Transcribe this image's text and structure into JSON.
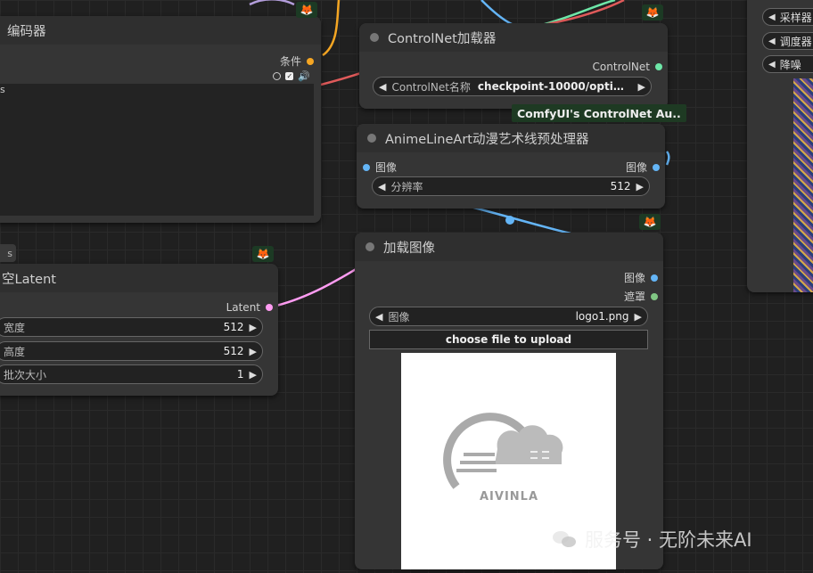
{
  "encoder_node": {
    "title": "编码器",
    "output_label": "条件",
    "input_label": "s",
    "badge_icon": "fox-icon"
  },
  "controlnet_loader": {
    "title": "ControlNet加载器",
    "output_label": "ControlNet",
    "widget_label": "ControlNet名称",
    "widget_value": "checkpoint-10000/optimi...",
    "tooltip": "ComfyUI's ControlNet Au..",
    "badge_icon": "fox-icon"
  },
  "lineart_node": {
    "title": "AnimeLineArt动漫艺术线预处理器",
    "input_label": "图像",
    "output_label": "图像",
    "widget_label": "分辨率",
    "widget_value": "512",
    "badge_icon": "fox-icon"
  },
  "latent_node": {
    "title": "空Latent",
    "tab_label": "s",
    "output_label": "Latent",
    "widgets": [
      {
        "label": "宽度",
        "value": "512"
      },
      {
        "label": "高度",
        "value": "512"
      },
      {
        "label": "批次大小",
        "value": "1"
      }
    ],
    "badge_icon": "fox-icon"
  },
  "load_image_node": {
    "title": "加载图像",
    "outputs": [
      "图像",
      "遮罩"
    ],
    "widget_label": "图像",
    "widget_value": "logo1.png",
    "upload_button": "choose file to upload",
    "preview_logo_text": "AIVINLA"
  },
  "sampler_node": {
    "items": [
      "采样器",
      "调度器",
      "降噪"
    ]
  },
  "watermark": {
    "text": "服务号 · 无阶未来AI"
  },
  "colors": {
    "conditioning": "#f5a623",
    "controlnet": "#6ee7a8",
    "image": "#64b5f6",
    "latent": "#ff9cf2",
    "mask": "#81c784"
  }
}
